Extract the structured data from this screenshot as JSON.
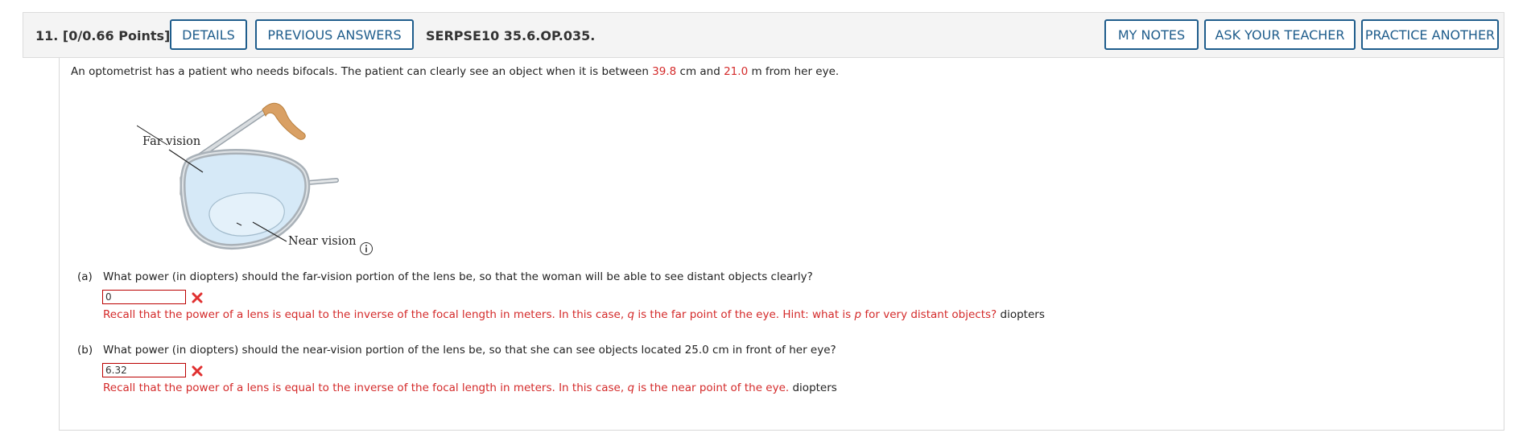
{
  "header": {
    "question_number": "11.",
    "points": "[0/0.66 Points]",
    "details_label": "DETAILS",
    "previous_answers_label": "PREVIOUS ANSWERS",
    "problem_code": "SERPSE10 35.6.OP.035.",
    "my_notes_label": "MY NOTES",
    "ask_teacher_label": "ASK YOUR TEACHER",
    "practice_another_label": "PRACTICE ANOTHER"
  },
  "problem": {
    "intro_prefix": "An optometrist has a patient who needs bifocals. The patient can clearly see an object when it is between ",
    "near_value": "39.8",
    "intro_mid1": " cm and ",
    "far_value": "21.0",
    "intro_suffix": " m from her eye."
  },
  "figure": {
    "far_label": "Far vision",
    "near_label": "Near vision"
  },
  "parts": [
    {
      "label": "(a)",
      "question": "What power (in diopters) should the far-vision portion of the lens be, so that the woman will be able to see distant objects clearly?",
      "answer_value": "0",
      "hint_1": "Recall that the power of a lens is equal to the inverse of the focal length in meters. In this case, ",
      "hint_var1": "q",
      "hint_2": " is the far point of the eye. Hint: what is ",
      "hint_var2": "p",
      "hint_3": " for very distant objects?",
      "unit": "diopters"
    },
    {
      "label": "(b)",
      "question": "What power (in diopters) should the near-vision portion of the lens be, so that she can see objects located 25.0 cm in front of her eye?",
      "answer_value": "6.32",
      "hint_1": "Recall that the power of a lens is equal to the inverse of the focal length in meters. In this case, ",
      "hint_var1": "q",
      "hint_2": " is the near point of the eye.",
      "unit": "diopters"
    }
  ],
  "colors": {
    "accent": "#1f5d8c",
    "error": "#d42a2a"
  },
  "icons": [
    "incorrect-x-icon",
    "info-icon"
  ]
}
